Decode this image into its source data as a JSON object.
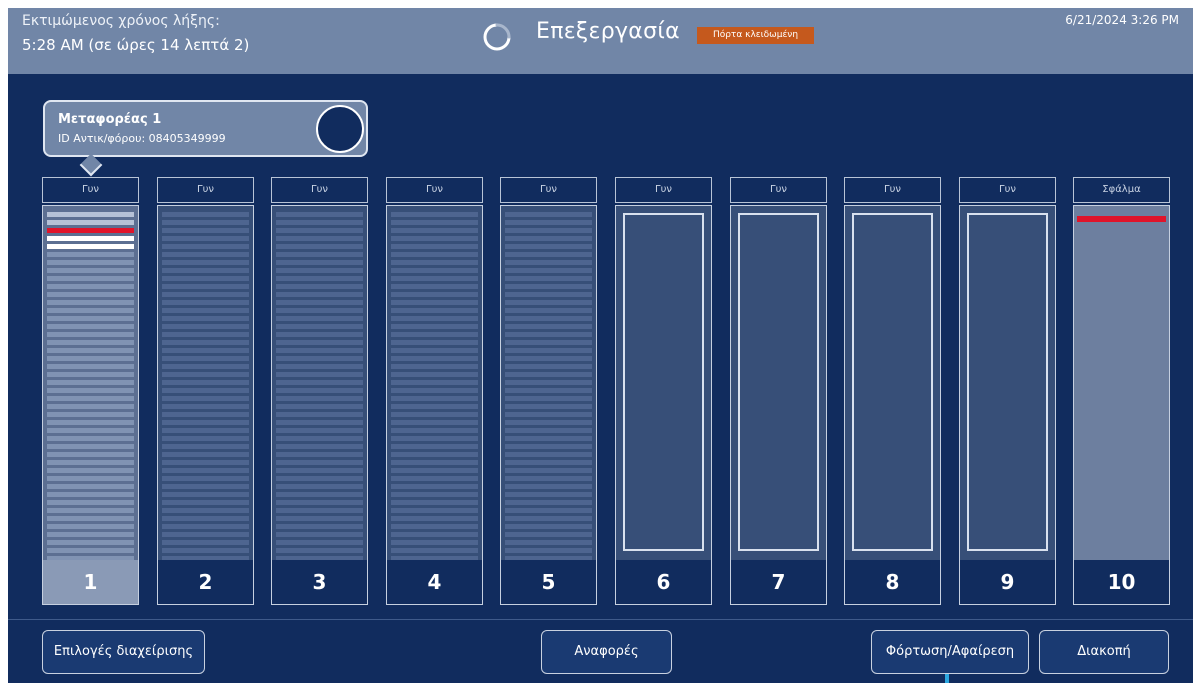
{
  "header": {
    "eta_label": "Εκτιμώμενος χρόνος λήξης:",
    "eta_value": "5:28 AM (σε ώρες 14 λεπτά 2)",
    "status": "Επεξεργασία",
    "door_badge": "Πόρτα κλειδωμένη",
    "datetime": "6/21/2024 3:26 PM"
  },
  "carrier": {
    "name": "Μεταφορέας 1",
    "id_text": "ID Αντικ/φόρου: 08405349999"
  },
  "slots": [
    {
      "label": "Γυν",
      "number": "1",
      "state": "selected"
    },
    {
      "label": "Γυν",
      "number": "2",
      "state": "loaded"
    },
    {
      "label": "Γυν",
      "number": "3",
      "state": "loaded"
    },
    {
      "label": "Γυν",
      "number": "4",
      "state": "loaded"
    },
    {
      "label": "Γυν",
      "number": "5",
      "state": "loaded"
    },
    {
      "label": "Γυν",
      "number": "6",
      "state": "empty"
    },
    {
      "label": "Γυν",
      "number": "7",
      "state": "empty"
    },
    {
      "label": "Γυν",
      "number": "8",
      "state": "empty"
    },
    {
      "label": "Γυν",
      "number": "9",
      "state": "empty"
    },
    {
      "label": "Σφάλμα",
      "number": "10",
      "state": "error"
    }
  ],
  "footer": {
    "admin_options": "Επιλογές διαχείρισης",
    "reports": "Αναφορές",
    "load_unload": "Φόρτωση/Αφαίρεση",
    "stop": "Διακοπή"
  },
  "colors": {
    "background": "#112c5e",
    "header": "#7186a7",
    "badge": "#c5591d",
    "error": "#e0142a"
  }
}
